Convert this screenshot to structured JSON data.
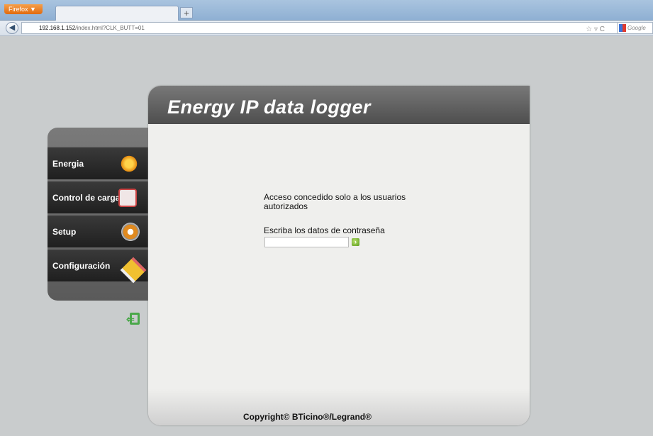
{
  "browser": {
    "menu_button": "Firefox ▼",
    "new_tab": "+",
    "url_host": "192.168.1.152",
    "url_path": "/index.html?CLK_BUTT=01",
    "search_placeholder": "Google"
  },
  "app": {
    "title": "Energy IP data logger",
    "copyright": "Copyright© BTicino®/Legrand®"
  },
  "menu": {
    "items": [
      {
        "label": "Energia",
        "icon": "energy-icon"
      },
      {
        "label": "Control de cargas",
        "icon": "plug-icon"
      },
      {
        "label": "Setup",
        "icon": "gear-icon"
      },
      {
        "label": "Configuración",
        "icon": "pencil-icon"
      }
    ]
  },
  "login": {
    "message": "Acceso concedido solo a los usuarios autorizados",
    "prompt": "Escriba los datos de contraseña",
    "password_value": ""
  }
}
